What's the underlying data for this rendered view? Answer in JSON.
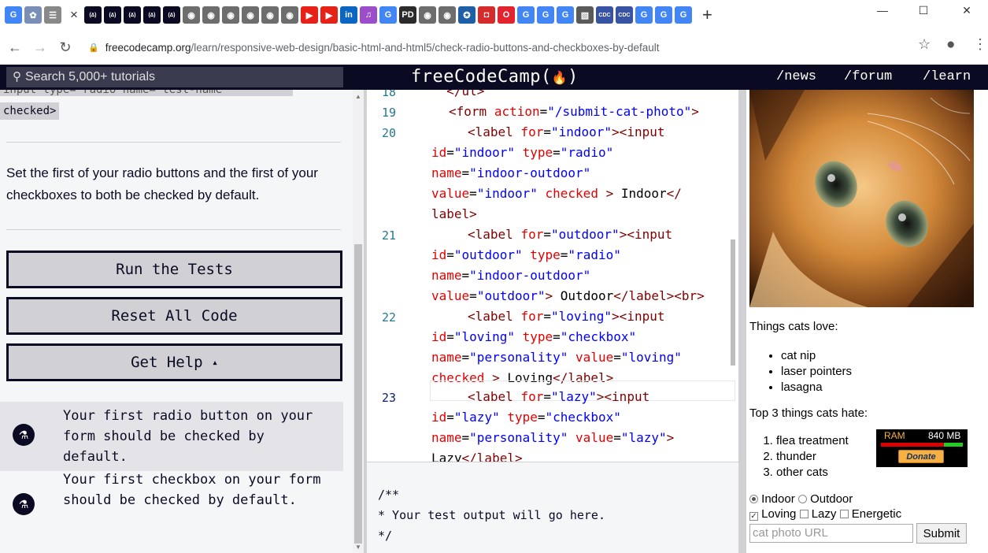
{
  "browser": {
    "tab_favicons": [
      {
        "icon": "google-icon",
        "glyph": "G",
        "bg": "#4285f4"
      },
      {
        "icon": "extension-icon",
        "glyph": "✿",
        "bg": "#7a8fb8"
      },
      {
        "icon": "list-icon",
        "glyph": "☰",
        "bg": "#888888"
      }
    ],
    "active_tab_close": "×",
    "other_tab_favicons": [
      {
        "icon": "fcc-icon",
        "glyph": "(∆)",
        "bg": "#0a0a23"
      },
      {
        "icon": "fcc-icon",
        "glyph": "(∆)",
        "bg": "#0a0a23"
      },
      {
        "icon": "fcc-icon",
        "glyph": "(∆)",
        "bg": "#0a0a23"
      },
      {
        "icon": "fcc-icon",
        "glyph": "(∆)",
        "bg": "#0a0a23"
      },
      {
        "icon": "fcc-icon",
        "glyph": "(∆)",
        "bg": "#0a0a23"
      },
      {
        "icon": "circle-icon",
        "glyph": "◉",
        "bg": "#6d6d6d"
      },
      {
        "icon": "circle-icon",
        "glyph": "◉",
        "bg": "#6d6d6d"
      },
      {
        "icon": "circle-icon",
        "glyph": "◉",
        "bg": "#6d6d6d"
      },
      {
        "icon": "circle-icon",
        "glyph": "◉",
        "bg": "#6d6d6d"
      },
      {
        "icon": "circle-icon",
        "glyph": "◉",
        "bg": "#6d6d6d"
      },
      {
        "icon": "circle-icon",
        "glyph": "◉",
        "bg": "#6d6d6d"
      },
      {
        "icon": "youtube-icon",
        "glyph": "▶",
        "bg": "#e62117"
      },
      {
        "icon": "youtube-icon",
        "glyph": "▶",
        "bg": "#e62117"
      },
      {
        "icon": "linkedin-icon",
        "glyph": "in",
        "bg": "#0a66c2"
      },
      {
        "icon": "podcast-icon",
        "glyph": "♫",
        "bg": "#9b4dca"
      },
      {
        "icon": "google-icon",
        "glyph": "G",
        "bg": "#4285f4"
      },
      {
        "icon": "pd-icon",
        "glyph": "PD",
        "bg": "#2b2b2b"
      },
      {
        "icon": "circle-icon",
        "glyph": "◉",
        "bg": "#6d6d6d"
      },
      {
        "icon": "circle-icon",
        "glyph": "◉",
        "bg": "#6d6d6d"
      },
      {
        "icon": "gear-badge-icon",
        "glyph": "✪",
        "bg": "#1f5fa8"
      },
      {
        "icon": "square-record-icon",
        "glyph": "◘",
        "bg": "#d62b2b"
      },
      {
        "icon": "opera-icon",
        "glyph": "O",
        "bg": "#e3232d"
      },
      {
        "icon": "google-icon",
        "glyph": "G",
        "bg": "#4285f4"
      },
      {
        "icon": "google-icon",
        "glyph": "G",
        "bg": "#4285f4"
      },
      {
        "icon": "google-icon",
        "glyph": "G",
        "bg": "#4285f4"
      },
      {
        "icon": "image-icon",
        "glyph": "▧",
        "bg": "#5a5a5a"
      },
      {
        "icon": "cdc-icon",
        "glyph": "CDC",
        "bg": "#3953a4"
      },
      {
        "icon": "cdc-icon",
        "glyph": "CDC",
        "bg": "#3953a4"
      },
      {
        "icon": "google-icon",
        "glyph": "G",
        "bg": "#4285f4"
      },
      {
        "icon": "google-icon",
        "glyph": "G",
        "bg": "#4285f4"
      },
      {
        "icon": "google-icon",
        "glyph": "G",
        "bg": "#4285f4"
      }
    ],
    "new_tab": "+",
    "url_domain": "freecodecamp.org",
    "url_path": "/learn/responsive-web-design/basic-html-and-html5/check-radio-buttons-and-checkboxes-by-default"
  },
  "header": {
    "search_placeholder": "Search 5,000+ tutorials",
    "logo": "freeCodeCamp(🔥)",
    "logo_text": "freeCodeCamp(",
    "logo_end": ")",
    "nav": [
      "/news",
      "/forum",
      "/learn"
    ]
  },
  "instructions": {
    "snippet_top": "input type= radio  name= test-name",
    "snippet_checked": "checked>",
    "text": "Set the first of your radio buttons and the first of your checkboxes to both be checked by default.",
    "buttons": {
      "run": "Run the Tests",
      "reset": "Reset All Code",
      "help": "Get Help"
    },
    "help_caret": "▴",
    "tests": [
      "Your first radio button on your form should be checked by default.",
      "Your first checkbox on your form should be checked by default."
    ]
  },
  "editor": {
    "line_numbers": [
      "18",
      "19",
      "20",
      "21",
      "22",
      "23"
    ],
    "output_lines": [
      "/**",
      "* Your test output will go here.",
      "*/"
    ]
  },
  "preview": {
    "love_heading": "Things cats love:",
    "love_items": [
      "cat nip",
      "laser pointers",
      "lasagna"
    ],
    "hate_heading": "Top 3 things cats hate:",
    "hate_items": [
      "flea treatment",
      "thunder",
      "other cats"
    ],
    "ram_label": "RAM",
    "ram_value": "840 MB",
    "donate": "Donate",
    "radio_indoor": "Indoor",
    "radio_outdoor": "Outdoor",
    "check_loving": "Loving",
    "check_lazy": "Lazy",
    "check_energetic": "Energetic",
    "url_placeholder": "cat photo URL",
    "submit": "Submit"
  }
}
